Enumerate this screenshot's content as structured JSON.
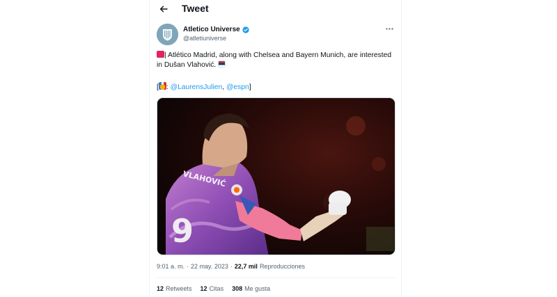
{
  "header": {
    "title": "Tweet",
    "back_icon": "arrow-left-icon"
  },
  "author": {
    "display_name": "Atletico Universe",
    "handle": "@atletiuniverse",
    "verified_icon": "verified-badge-icon",
    "verified_color": "#1d9bf0"
  },
  "tweet": {
    "leading_emoji": "siren-emoji",
    "text": "| Atlético Madrid, along with Chelsea and Bayern Munich, are interested in Dušan Vlahović.",
    "trailing_emoji": "serbia-flag-emoji",
    "credit_open": "[",
    "credit_emoji": "medal-emoji",
    "credit_sep": ":",
    "mention_1": "@LaurensJulien",
    "comma": ",",
    "mention_2": "@espn",
    "credit_close": "]"
  },
  "media": {
    "alt": "Player celebrating with clenched fist"
  },
  "meta": {
    "time": "9:01 a. m.",
    "dot": "·",
    "date": "22 may. 2023",
    "dot2": "·",
    "views": "22,7 mil",
    "views_label": "Reproducciones"
  },
  "stats": {
    "retweets": "12",
    "retweets_label": "Retweets",
    "quotes": "12",
    "quotes_label": "Citas",
    "likes": "308",
    "likes_label": "Me gusta"
  },
  "colors": {
    "link": "#1d9bf0",
    "secondary_text": "#536471",
    "border": "#eff3f4"
  }
}
